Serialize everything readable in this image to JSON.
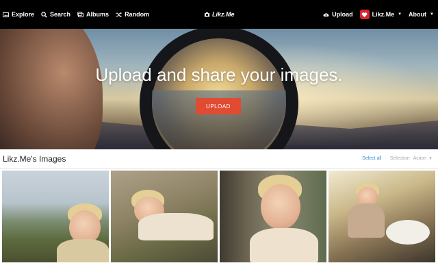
{
  "nav": {
    "explore": "Explore",
    "search": "Search",
    "albums": "Albums",
    "random": "Random",
    "brand": "Likz.Me",
    "upload": "Upload",
    "user": "Likz.Me",
    "about": "About"
  },
  "hero": {
    "title": "Upload and share your images.",
    "button": "UPLOAD"
  },
  "section": {
    "title": "Likz.Me's Images",
    "select_all": "Select all",
    "separator": "·",
    "selection": "Selection",
    "action": "Action"
  },
  "images": [
    {
      "alt": "child lying in grass by lake"
    },
    {
      "alt": "child lying on rock"
    },
    {
      "alt": "child in forest"
    },
    {
      "alt": "child with rabbit"
    }
  ],
  "colors": {
    "topbar": "#000000",
    "upload_button": "#e04b32",
    "link": "#3b8fd9",
    "avatar": "#d9262b"
  }
}
